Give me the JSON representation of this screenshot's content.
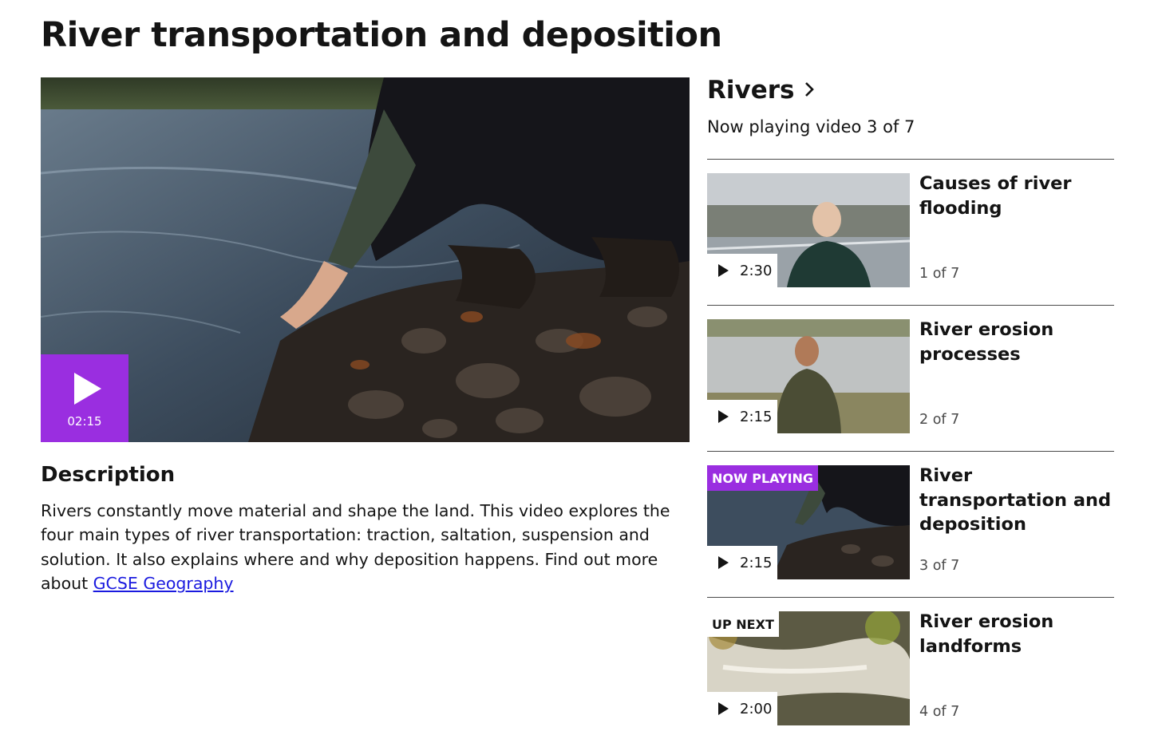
{
  "page": {
    "title": "River transportation and deposition"
  },
  "player": {
    "duration": "02:15"
  },
  "description": {
    "heading": "Description",
    "text": "Rivers constantly move material and shape the land. This video explores the four main types of river transportation: traction, saltation, suspension and solution. It also explains where and why deposition happens. Find out more about ",
    "link_text": "GCSE Geography"
  },
  "sidebar": {
    "title": "Rivers",
    "subtitle": "Now playing video 3 of 7",
    "items": [
      {
        "title": "Causes of river flooding",
        "duration": "2:30",
        "count": "1 of 7",
        "badge": ""
      },
      {
        "title": "River erosion processes",
        "duration": "2:15",
        "count": "2 of 7",
        "badge": ""
      },
      {
        "title": "River transportation and deposition",
        "duration": "2:15",
        "count": "3 of 7",
        "badge": "NOW PLAYING"
      },
      {
        "title": "River erosion landforms",
        "duration": "2:00",
        "count": "4 of 7",
        "badge": "UP NEXT"
      }
    ]
  },
  "colors": {
    "accent": "#9a2ee0",
    "link": "#1a1adf"
  }
}
